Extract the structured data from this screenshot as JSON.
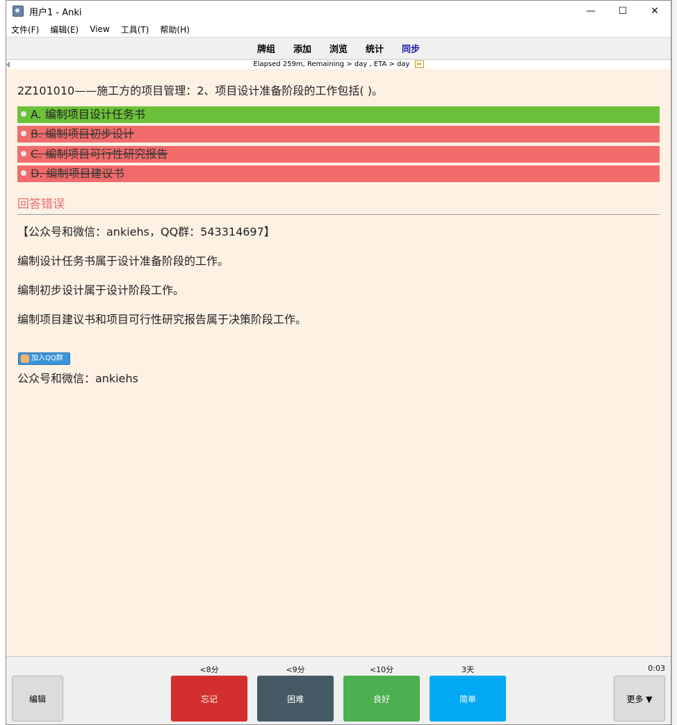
{
  "window": {
    "title": "用户1 - Anki"
  },
  "menu": [
    "文件(F)",
    "编辑(E)",
    "View",
    "工具(T)",
    "帮助(H)"
  ],
  "toolbar": {
    "decks": "牌组",
    "add": "添加",
    "browse": "浏览",
    "stats": "统计",
    "sync": "同步"
  },
  "status": {
    "text": "Elapsed 259m, Remaining > day , ETA > day"
  },
  "card": {
    "question": "2Z101010——施工方的项目管理：2、项目设计准备阶段的工作包括( )。",
    "options": [
      {
        "label": "A. 编制项目设计任务书",
        "state": "correct"
      },
      {
        "label": "B. 编制项目初步设计",
        "state": "wrong"
      },
      {
        "label": "C. 编制项目可行性研究报告",
        "state": "wrong"
      },
      {
        "label": "D. 编制项目建议书",
        "state": "wrong"
      }
    ],
    "result": "回答错误",
    "notes": [
      "【公众号和微信：ankiehs，QQ群：543314697】",
      "编制设计任务书属于设计准备阶段的工作。",
      "编制初步设计属于设计阶段工作。",
      "编制项目建议书和项目可行性研究报告属于决策阶段工作。"
    ],
    "qq_button": "加入QQ群",
    "footer": "公众号和微信：ankiehs"
  },
  "bottom": {
    "edit": "编辑",
    "more": "更多 ▼",
    "timer": "0:03",
    "answers": [
      {
        "label": "忘记",
        "interval": "<8分",
        "color": "#d32f2f"
      },
      {
        "label": "困难",
        "interval": "<9分",
        "color": "#455a64"
      },
      {
        "label": "良好",
        "interval": "<10分",
        "color": "#4caf50"
      },
      {
        "label": "简单",
        "interval": "3天",
        "color": "#03a9f4"
      }
    ]
  }
}
